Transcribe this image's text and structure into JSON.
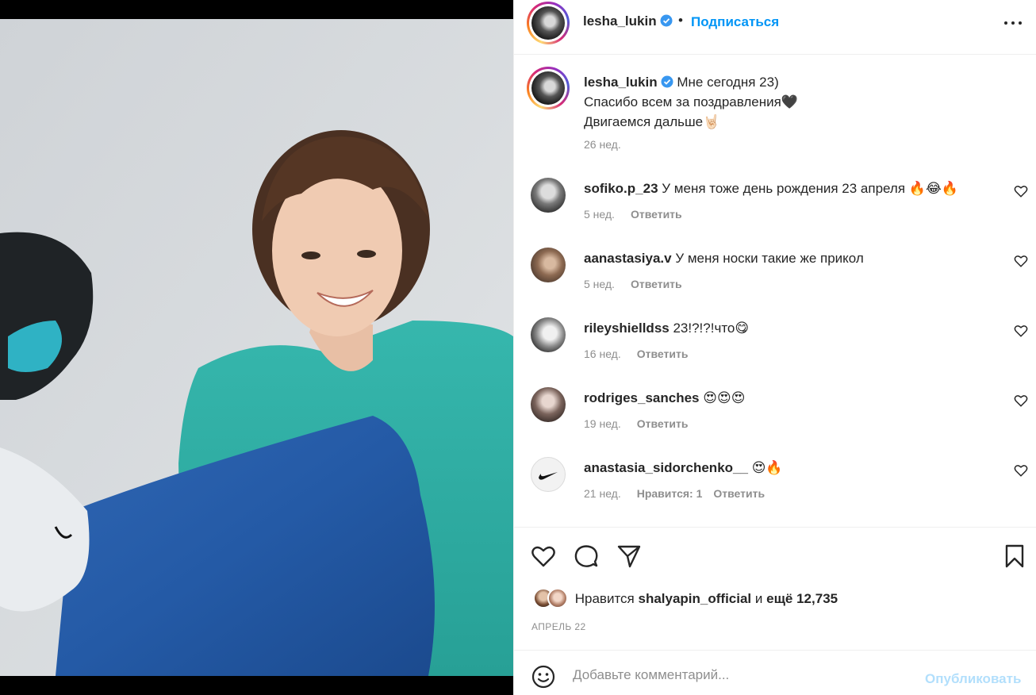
{
  "post": {
    "author": "lesha_lukin",
    "follow_label": "Подписаться",
    "separator": "•",
    "caption_lines": [
      "Мне сегодня 23)",
      "Спасибо всем за поздравления🖤",
      "Двигаемся дальше🤘🏻"
    ],
    "caption_time": "26 нед."
  },
  "comments": [
    {
      "user": "sofiko.p_23",
      "text": "У меня тоже день рождения 23 апреля 🔥😂🔥",
      "time": "5 нед.",
      "likes": "",
      "reply": "Ответить"
    },
    {
      "user": "aanastasiya.v",
      "text": "У меня носки такие же прикол",
      "time": "5 нед.",
      "likes": "",
      "reply": "Ответить"
    },
    {
      "user": "rileyshielldss",
      "text": "23!?!?!что😋",
      "time": "16 нед.",
      "likes": "",
      "reply": "Ответить"
    },
    {
      "user": "rodriges_sanches",
      "text": "😍😍😍",
      "time": "19 нед.",
      "likes": "",
      "reply": "Ответить"
    },
    {
      "user": "anastasia_sidorchenko__",
      "text": "😍🔥",
      "time": "21 нед.",
      "likes": "Нравится: 1",
      "reply": "Ответить"
    }
  ],
  "likes": {
    "prefix": "Нравится",
    "user": "shalyapin_official",
    "middle": "и",
    "count": "ещё 12,735"
  },
  "date": "АПРЕЛЬ 22",
  "add_comment": {
    "placeholder": "Добавьте комментарий...",
    "publish_label": "Опубликовать"
  },
  "colors": {
    "link": "#0095f6",
    "publish_disabled": "#b2dffc",
    "muted": "#8e8e8e"
  },
  "icons": [
    "verified-badge-icon",
    "more-options-icon",
    "heart-icon",
    "comment-icon",
    "share-icon",
    "bookmark-icon",
    "emoji-icon"
  ]
}
